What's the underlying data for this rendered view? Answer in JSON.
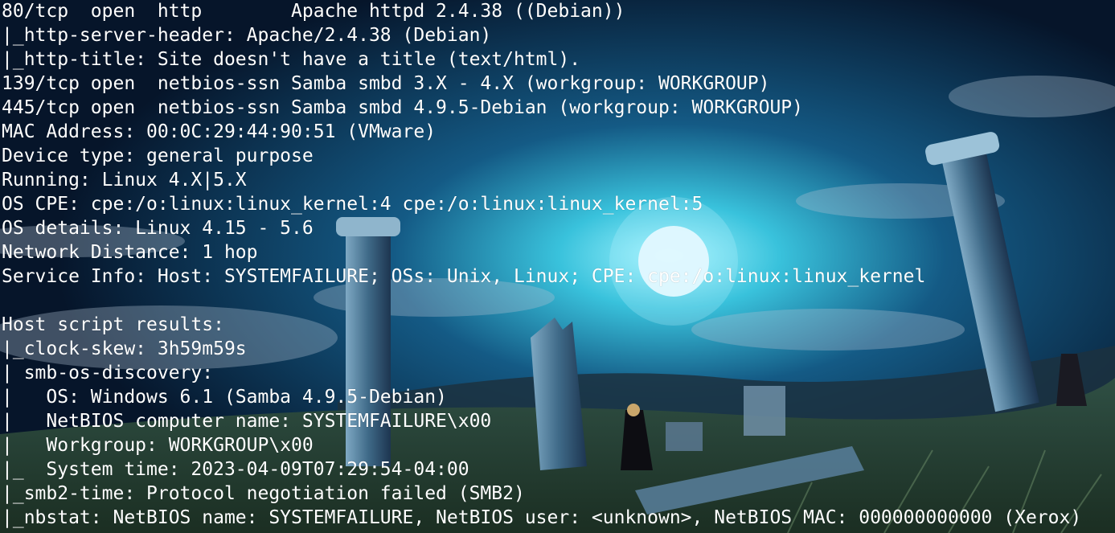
{
  "terminal": {
    "lines": [
      "80/tcp  open  http        Apache httpd 2.4.38 ((Debian))",
      "|_http-server-header: Apache/2.4.38 (Debian)",
      "|_http-title: Site doesn't have a title (text/html).",
      "139/tcp open  netbios-ssn Samba smbd 3.X - 4.X (workgroup: WORKGROUP)",
      "445/tcp open  netbios-ssn Samba smbd 4.9.5-Debian (workgroup: WORKGROUP)",
      "MAC Address: 00:0C:29:44:90:51 (VMware)",
      "Device type: general purpose",
      "Running: Linux 4.X|5.X",
      "OS CPE: cpe:/o:linux:linux_kernel:4 cpe:/o:linux:linux_kernel:5",
      "OS details: Linux 4.15 - 5.6",
      "Network Distance: 1 hop",
      "Service Info: Host: SYSTEMFAILURE; OSs: Unix, Linux; CPE: cpe:/o:linux:linux_kernel",
      "",
      "Host script results:",
      "|_clock-skew: 3h59m59s",
      "| smb-os-discovery:",
      "|   OS: Windows 6.1 (Samba 4.9.5-Debian)",
      "|   NetBIOS computer name: SYSTEMFAILURE\\x00",
      "|   Workgroup: WORKGROUP\\x00",
      "|_  System time: 2023-04-09T07:29:54-04:00",
      "|_smb2-time: Protocol negotiation failed (SMB2)",
      "|_nbstat: NetBIOS name: SYSTEMFAILURE, NetBIOS user: <unknown>, NetBIOS MAC: 000000000000 (Xerox)"
    ]
  },
  "colors": {
    "text": "#ffffff",
    "sky_top": "#07162a",
    "sky_glow": "#3fc6e0",
    "moon": "#e8f7ff",
    "grass": "#3a5a3a"
  }
}
